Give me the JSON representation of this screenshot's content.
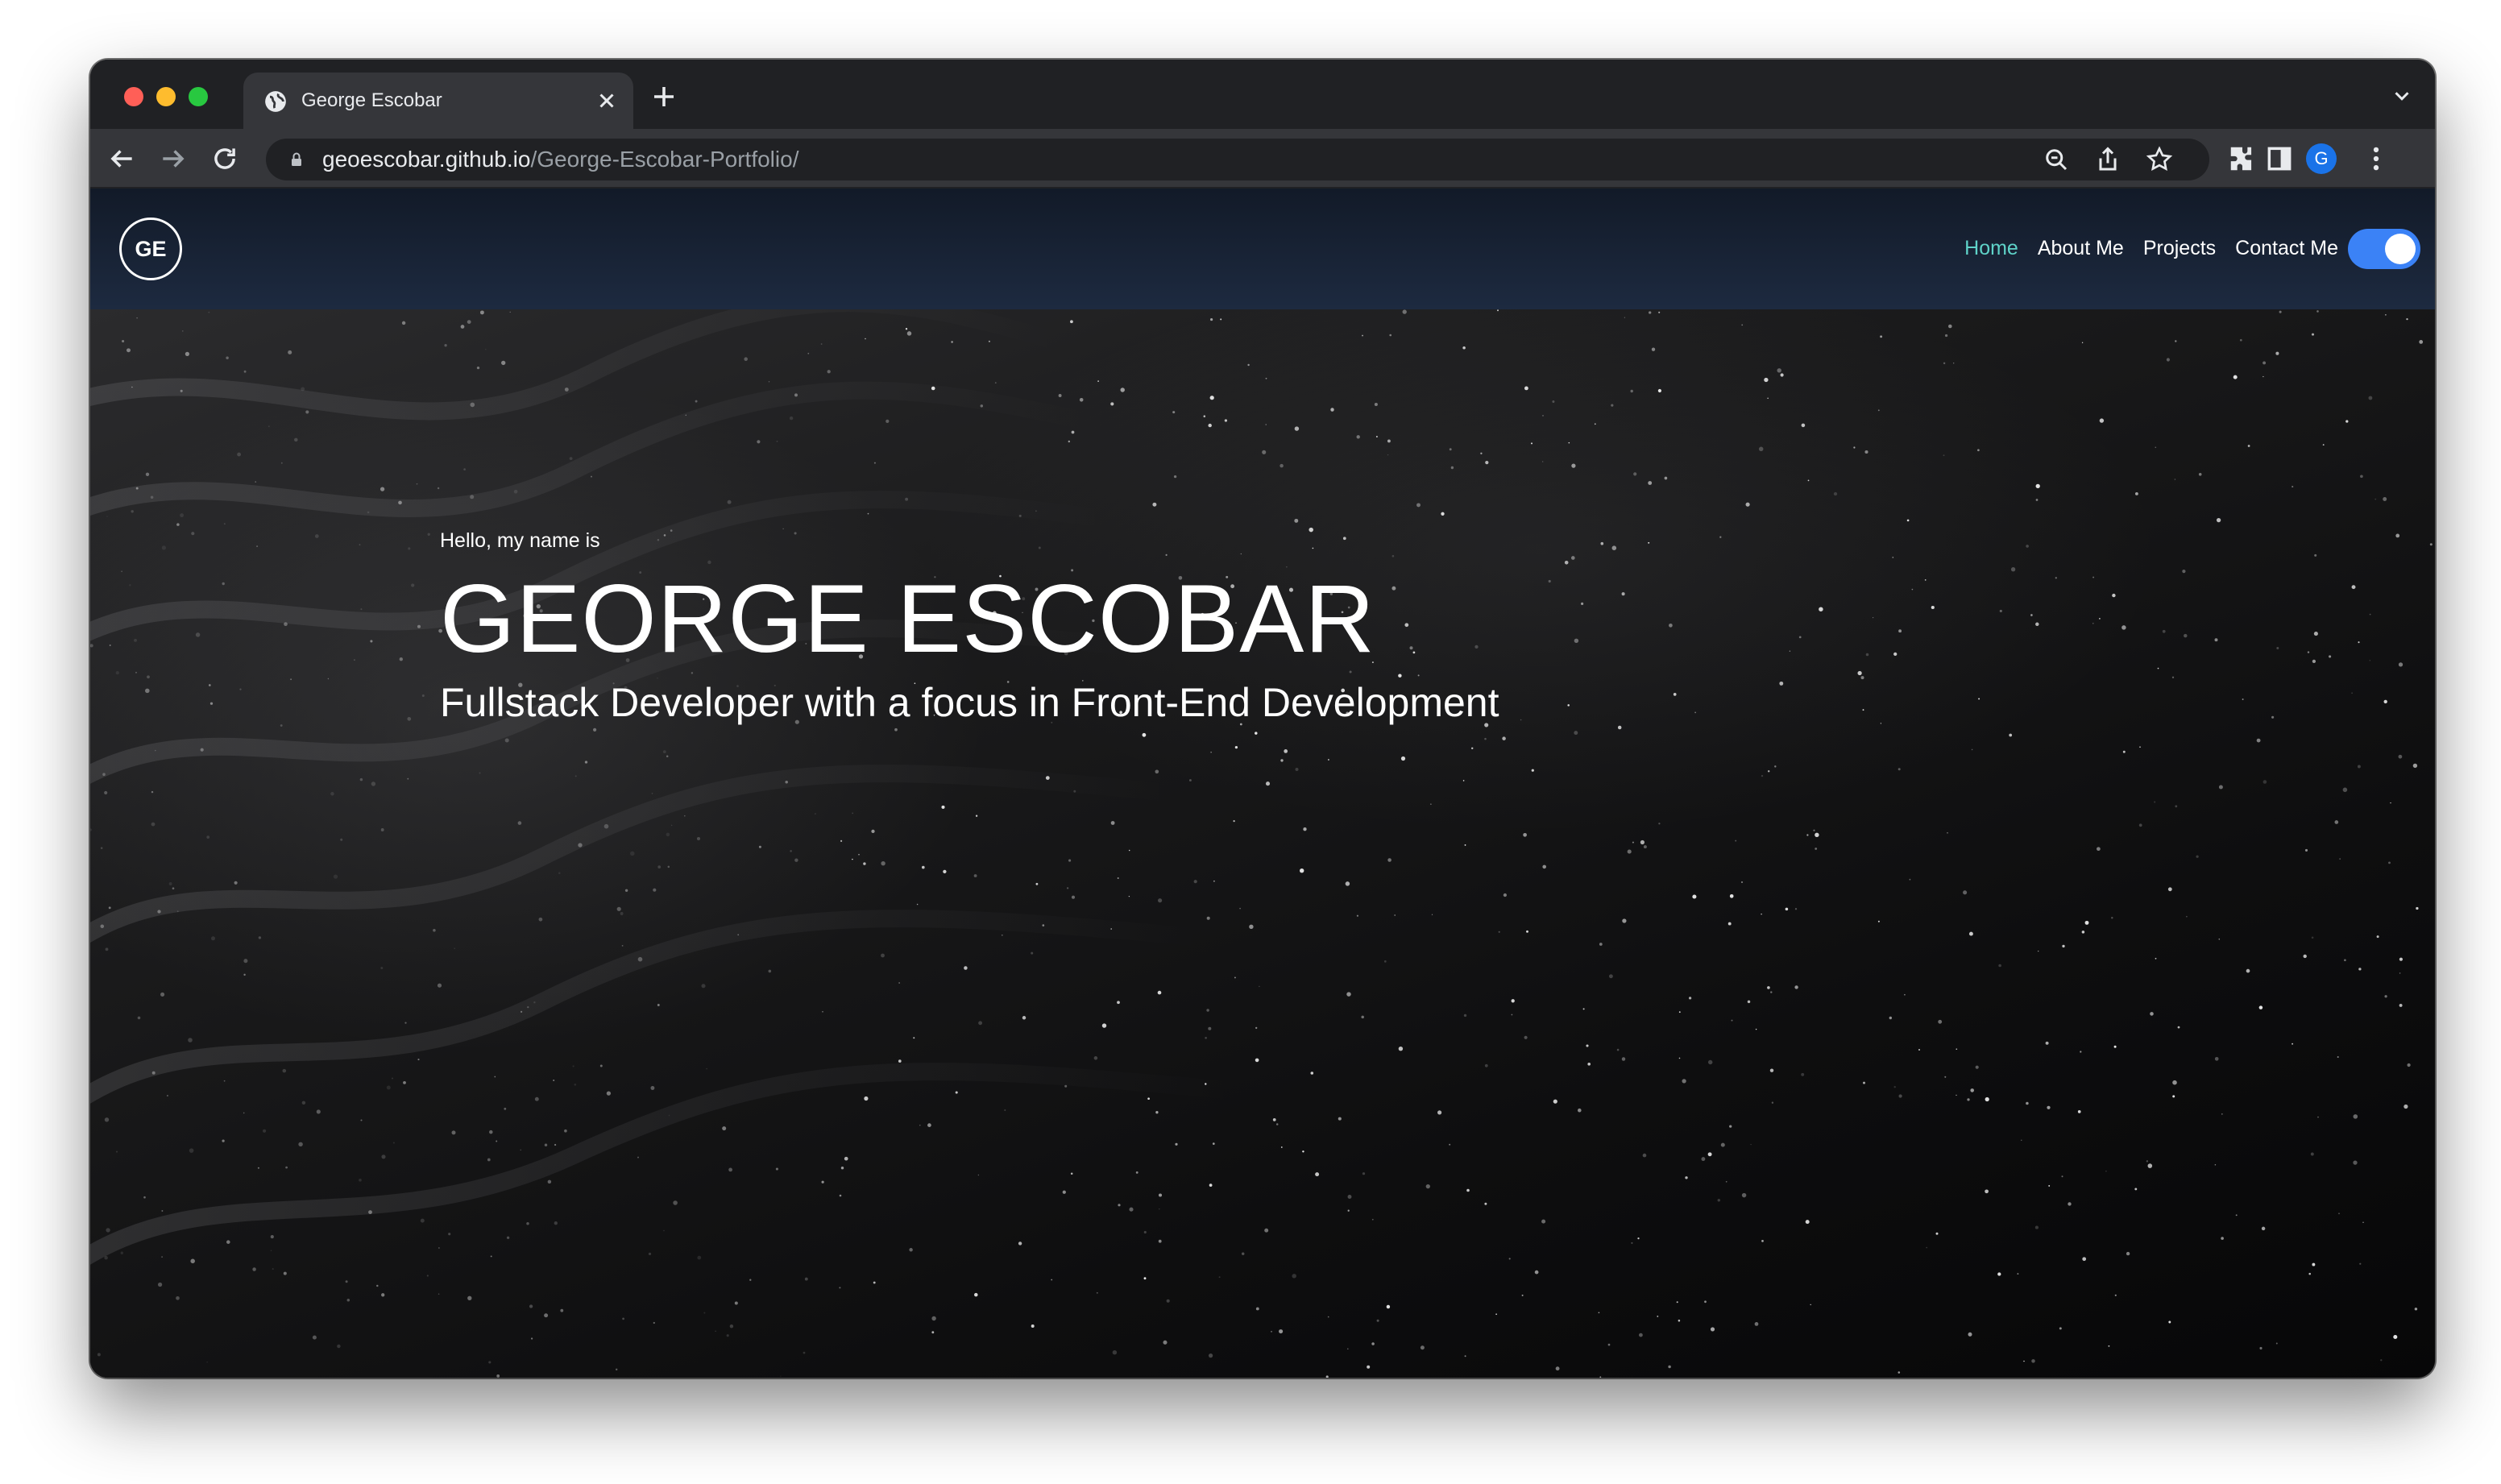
{
  "browser": {
    "tab": {
      "title": "George Escobar",
      "favicon": "globe-icon"
    },
    "url": {
      "host": "geoescobar.github.io",
      "path": "/George-Escobar-Portfolio/"
    },
    "profile_initial": "G",
    "icons": [
      "back-arrow-icon",
      "forward-arrow-icon",
      "reload-icon",
      "lock-icon",
      "zoom-icon",
      "share-icon",
      "star-icon",
      "extensions-icon",
      "side-panel-icon",
      "kebab-menu-icon"
    ]
  },
  "site": {
    "logo_text": "GE",
    "nav": [
      {
        "label": "Home",
        "active": true
      },
      {
        "label": "About Me",
        "active": false
      },
      {
        "label": "Projects",
        "active": false
      },
      {
        "label": "Contact Me",
        "active": false
      }
    ],
    "theme_toggle_on": true,
    "hero": {
      "greeting": "Hello, my name is",
      "name": "GEORGE ESCOBAR",
      "subtitle": "Fullstack Developer with a focus in Front-End Development"
    }
  },
  "colors": {
    "accent_active_nav": "#5fd3c9",
    "toggle": "#3b82f6",
    "navbar_top": "#121a28",
    "navbar_bottom": "#1d2a40"
  }
}
